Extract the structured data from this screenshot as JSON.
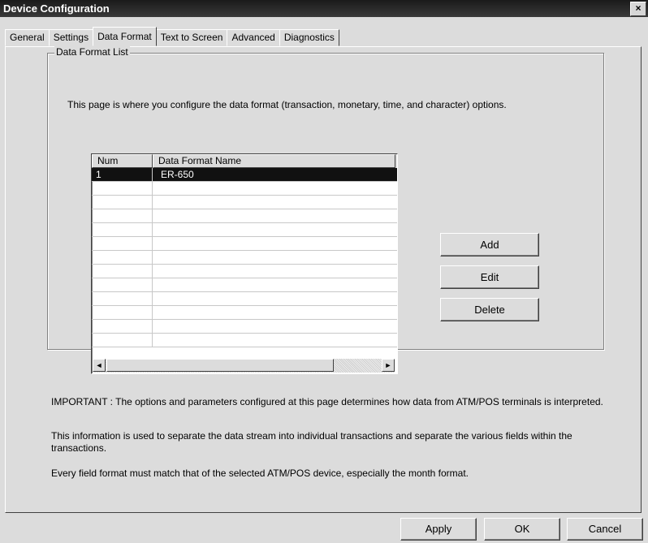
{
  "window": {
    "title": "Device Configuration",
    "close_glyph": "×"
  },
  "tabs": [
    "General",
    "Settings",
    "Data Format",
    "Text to Screen",
    "Advanced",
    "Diagnostics"
  ],
  "active_tab": "Data Format",
  "group": {
    "legend": "Data Format List",
    "description": "This page is where you configure the data format (transaction, monetary, time, and character) options."
  },
  "list": {
    "columns": [
      "Num",
      "Data Format Name"
    ],
    "rows": [
      {
        "num": "1",
        "name": "ER-650",
        "selected": true
      }
    ]
  },
  "buttons": {
    "add": "Add",
    "edit": "Edit",
    "delete": "Delete"
  },
  "notes": [
    "IMPORTANT : The options and parameters configured at this page determines how data from ATM/POS terminals is interpreted.",
    "This information is used to separate the data stream into individual transactions and separate the various fields within the transactions.",
    "Every field format must match that of the selected ATM/POS device, especially the month format."
  ],
  "footer": {
    "apply": "Apply",
    "ok": "OK",
    "cancel": "Cancel"
  },
  "scrollbar": {
    "left_glyph": "◄",
    "right_glyph": "►"
  }
}
